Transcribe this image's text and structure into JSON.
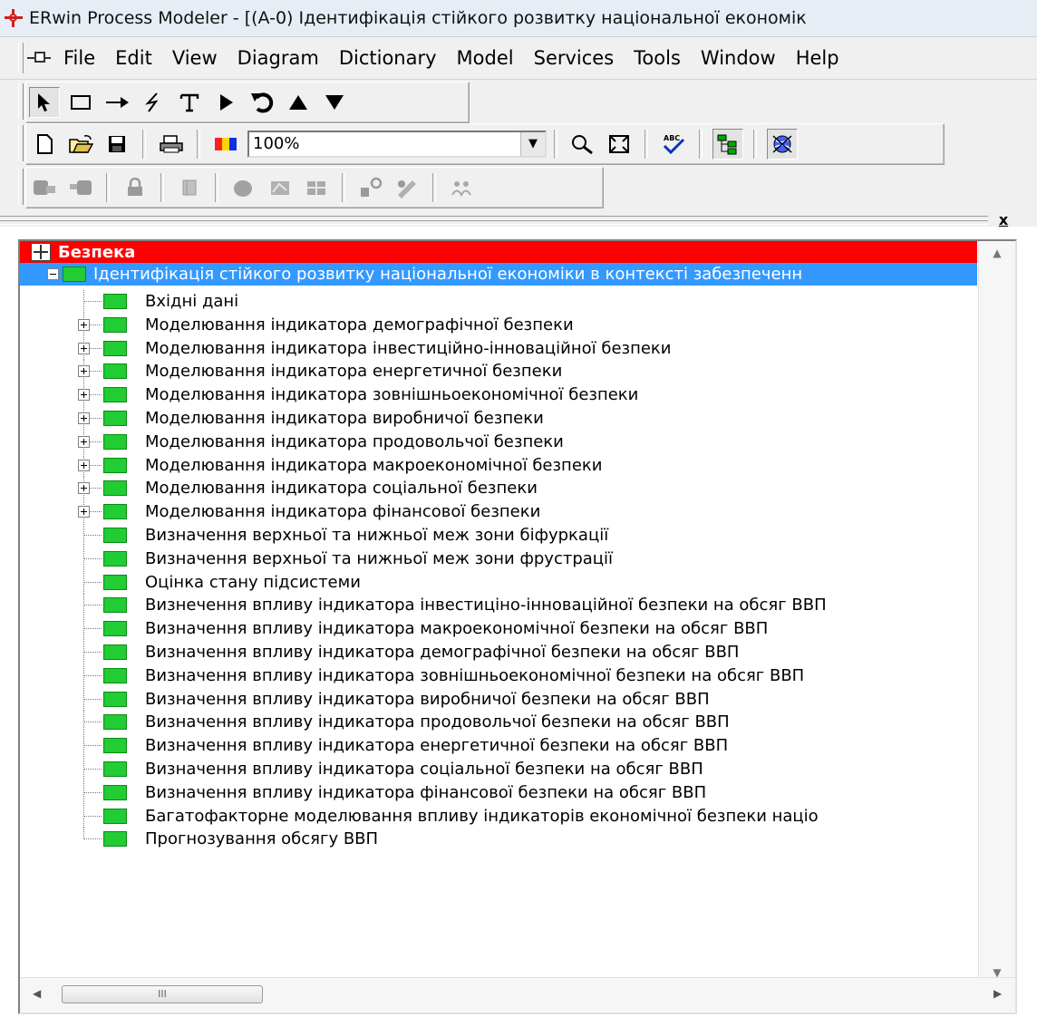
{
  "window": {
    "title": "ERwin Process Modeler - [(A-0) Ідентифікація стійкого розвитку національної економік"
  },
  "menu": [
    "File",
    "Edit",
    "View",
    "Diagram",
    "Dictionary",
    "Model",
    "Services",
    "Tools",
    "Window",
    "Help"
  ],
  "toolbar": {
    "zoom_value": "100%"
  },
  "splitter": {
    "close_label": "x"
  },
  "tree": {
    "root_label": "Безпека",
    "selected_label": "Ідентифікація стійкого розвитку національної економіки в контексті забезпеченн",
    "items": [
      {
        "label": "Вхідні дані",
        "expandable": false
      },
      {
        "label": "Моделювання індикатора демографічної безпеки",
        "expandable": true
      },
      {
        "label": "Моделювання індикатора інвестиційно-інноваційної безпеки",
        "expandable": true
      },
      {
        "label": "Моделювання індикатора енергетичної безпеки",
        "expandable": true
      },
      {
        "label": "Моделювання індикатора зовнішньоекономічної безпеки",
        "expandable": true
      },
      {
        "label": "Моделювання індикатора виробничої  безпеки",
        "expandable": true
      },
      {
        "label": "Моделювання індикатора продовольчої безпеки",
        "expandable": true
      },
      {
        "label": "Моделювання індикатора макроекономічної безпеки",
        "expandable": true
      },
      {
        "label": "Моделювання індикатора соціальної  безпеки",
        "expandable": true
      },
      {
        "label": "Моделювання індикатора фінансової безпеки",
        "expandable": true
      },
      {
        "label": "Визначення верхньої та нижньої меж зони біфуркації",
        "expandable": false
      },
      {
        "label": "Визначення верхньої та нижньої меж зони фрустрації",
        "expandable": false
      },
      {
        "label": "Оцінка стану підсистеми",
        "expandable": false
      },
      {
        "label": "Визнечення впливу індикатора інвестиціно-інноваційної  безпеки на обсяг ВВП",
        "expandable": false
      },
      {
        "label": "Визначення впливу індикатора макроекономічної  безпеки на обсяг ВВП",
        "expandable": false
      },
      {
        "label": "Визначення впливу індикатора демографічної  безпеки на обсяг ВВП",
        "expandable": false
      },
      {
        "label": "Визначення впливу індикатора зовнішньоекономічної  безпеки на обсяг ВВП",
        "expandable": false
      },
      {
        "label": "Визначення впливу індикатора  виробничої безпеки на обсяг ВВП",
        "expandable": false
      },
      {
        "label": "Визначення впливу індикатора продовольчої  безпеки на обсяг ВВП",
        "expandable": false
      },
      {
        "label": "Визначення впливу індикатора енергетичної  безпеки на обсяг ВВП",
        "expandable": false
      },
      {
        "label": "Визначення впливу індикатора соціальної  безпеки на обсяг ВВП",
        "expandable": false
      },
      {
        "label": "Визначення впливу індикатора фінансової  безпеки на обсяг ВВП",
        "expandable": false
      },
      {
        "label": "Багатофакторне моделювання  впливу індикаторів економічної  безпеки націо",
        "expandable": false
      },
      {
        "label": "Прогнозування обсягу ВВП",
        "expandable": false
      }
    ]
  },
  "scrollbar": {
    "thumb_grip": "III"
  },
  "colors": {
    "root_highlight": "#ff0000",
    "selection": "#3399ff",
    "activity_box": "#22cc33"
  },
  "icons": {
    "toolbar1": [
      "pointer-icon",
      "rectangle-icon",
      "arrow-icon",
      "squiggle-icon",
      "text-icon",
      "triangle-right-icon",
      "rotate-icon",
      "triangle-up-icon",
      "triangle-down-icon"
    ],
    "toolbar2": [
      "new-icon",
      "open-icon",
      "save-icon",
      "print-icon",
      "color-icon",
      "zoom-icon",
      "zoom-fit-icon",
      "spell-check-icon",
      "model-explorer-icon",
      "globe-icon"
    ]
  }
}
